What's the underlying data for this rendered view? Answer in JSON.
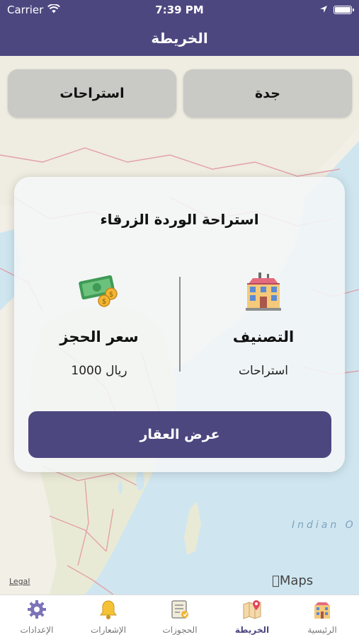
{
  "status_bar": {
    "carrier": "Carrier",
    "time": "7:39 PM"
  },
  "header": {
    "title": "الخريطة"
  },
  "filters": {
    "city": "جدة",
    "type": "استراحات"
  },
  "card": {
    "title": "استراحة الوردة الزرقاء",
    "category_label": "التصنيف",
    "category_value": "استراحات",
    "price_label": "سعر الحجز",
    "price_value": "1000",
    "price_currency": "ريال",
    "action_label": "عرض العقار"
  },
  "map": {
    "legal": "Legal",
    "provider": "Maps",
    "ocean_label": "Indian O"
  },
  "tabs": [
    {
      "label": "الرئيسية",
      "icon": "building-icon"
    },
    {
      "label": "الخريطة",
      "icon": "map-icon"
    },
    {
      "label": "الحجوزات",
      "icon": "booking-icon"
    },
    {
      "label": "الإشعارات",
      "icon": "bell-icon"
    },
    {
      "label": "الإعدادات",
      "icon": "gear-icon"
    }
  ],
  "active_tab": "الخريطة",
  "colors": {
    "brand": "#4d4780",
    "filter_bg": "#c9c9c6",
    "water": "#cfe6f0"
  }
}
